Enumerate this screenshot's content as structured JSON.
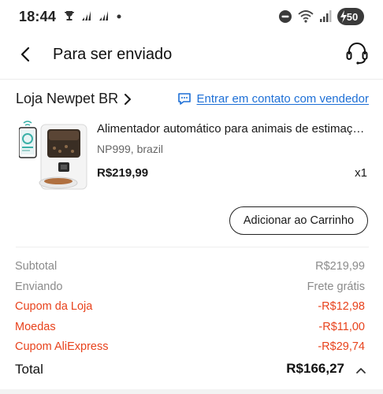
{
  "status_bar": {
    "time": "18:44",
    "battery": "50",
    "left_icons": [
      "trophy-icon",
      "signal-icon",
      "signal-icon",
      "dot-icon"
    ],
    "right_icons": [
      "do-not-disturb-icon",
      "wifi-icon",
      "cell-signal-icon",
      "battery-charging-icon"
    ]
  },
  "header": {
    "title": "Para ser enviado",
    "back_icon": "chevron-left-icon",
    "support_icon": "headset-icon"
  },
  "store": {
    "name": "Loja Newpet BR",
    "contact_label": "Entrar em contato com vendedor"
  },
  "product": {
    "title": "Alimentador automático para animais de estimação...",
    "sku": "NP999, brazil",
    "price": "R$219,99",
    "quantity": "x1",
    "add_to_cart_label": "Adicionar ao Carrinho"
  },
  "summary": {
    "rows": [
      {
        "label": "Subtotal",
        "value": "R$219,99"
      },
      {
        "label": "Enviando",
        "value": "Frete grátis"
      },
      {
        "label": "Cupom da Loja",
        "value": "-R$12,98"
      },
      {
        "label": "Moedas",
        "value": "-R$11,00"
      },
      {
        "label": "Cupom AliExpress",
        "value": "-R$29,74"
      }
    ],
    "total_label": "Total",
    "total_value": "R$166,27"
  },
  "colors": {
    "accent_red": "#e8421c",
    "link_blue": "#1d6fd6",
    "muted_gray": "#8b8b8b"
  }
}
